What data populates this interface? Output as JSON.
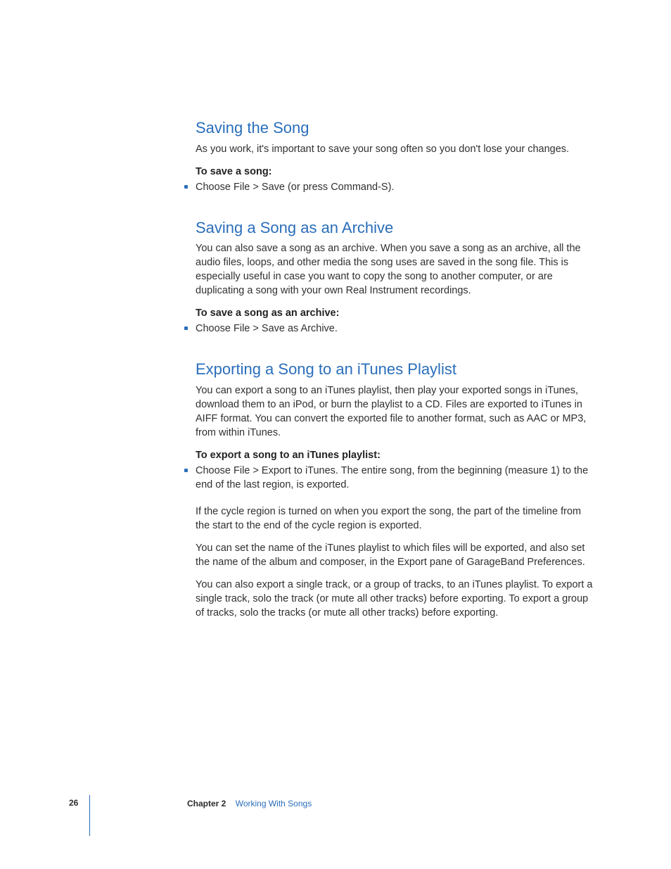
{
  "colors": {
    "accent": "#2a6ebb"
  },
  "sections": [
    {
      "heading": "Saving the Song",
      "intro": "As you work, it's important to save your song often so you don't lose your changes.",
      "subhead": "To save a song:",
      "bullets": [
        "Choose File > Save (or press Command-S)."
      ],
      "paragraphs": []
    },
    {
      "heading": "Saving a Song as an Archive",
      "intro": "You can also save a song as an archive. When you save a song as an archive, all the audio files, loops, and other media the song uses are saved in the song file. This is especially useful in case you want to copy the song to another computer, or are duplicating a song with your own Real Instrument recordings.",
      "subhead": "To save a song as an archive:",
      "bullets": [
        "Choose File > Save as Archive."
      ],
      "paragraphs": []
    },
    {
      "heading": "Exporting a Song to an iTunes Playlist",
      "intro": "You can export a song to an iTunes playlist, then play your exported songs in iTunes, download them to an iPod, or burn the playlist to a CD. Files are exported to iTunes in AIFF format. You can convert the exported file to another format, such as AAC or MP3, from within iTunes.",
      "subhead": "To export a song to an iTunes playlist:",
      "bullets": [
        "Choose File > Export to iTunes. The entire song, from the beginning (measure 1) to the end of the last region, is exported."
      ],
      "paragraphs": [
        "If the cycle region is turned on when you export the song, the part of the timeline from the start to the end of the cycle region is exported.",
        "You can set the name of the iTunes playlist to which files will be exported, and also set the name of the album and composer, in the Export pane of GarageBand Preferences.",
        "You can also export a single track, or a group of tracks, to an iTunes playlist. To export a single track, solo the track (or mute all other tracks) before exporting. To export a group of tracks, solo the tracks (or mute all other tracks) before exporting."
      ]
    }
  ],
  "footer": {
    "page_number": "26",
    "chapter_label": "Chapter 2",
    "chapter_title": "Working With Songs"
  }
}
